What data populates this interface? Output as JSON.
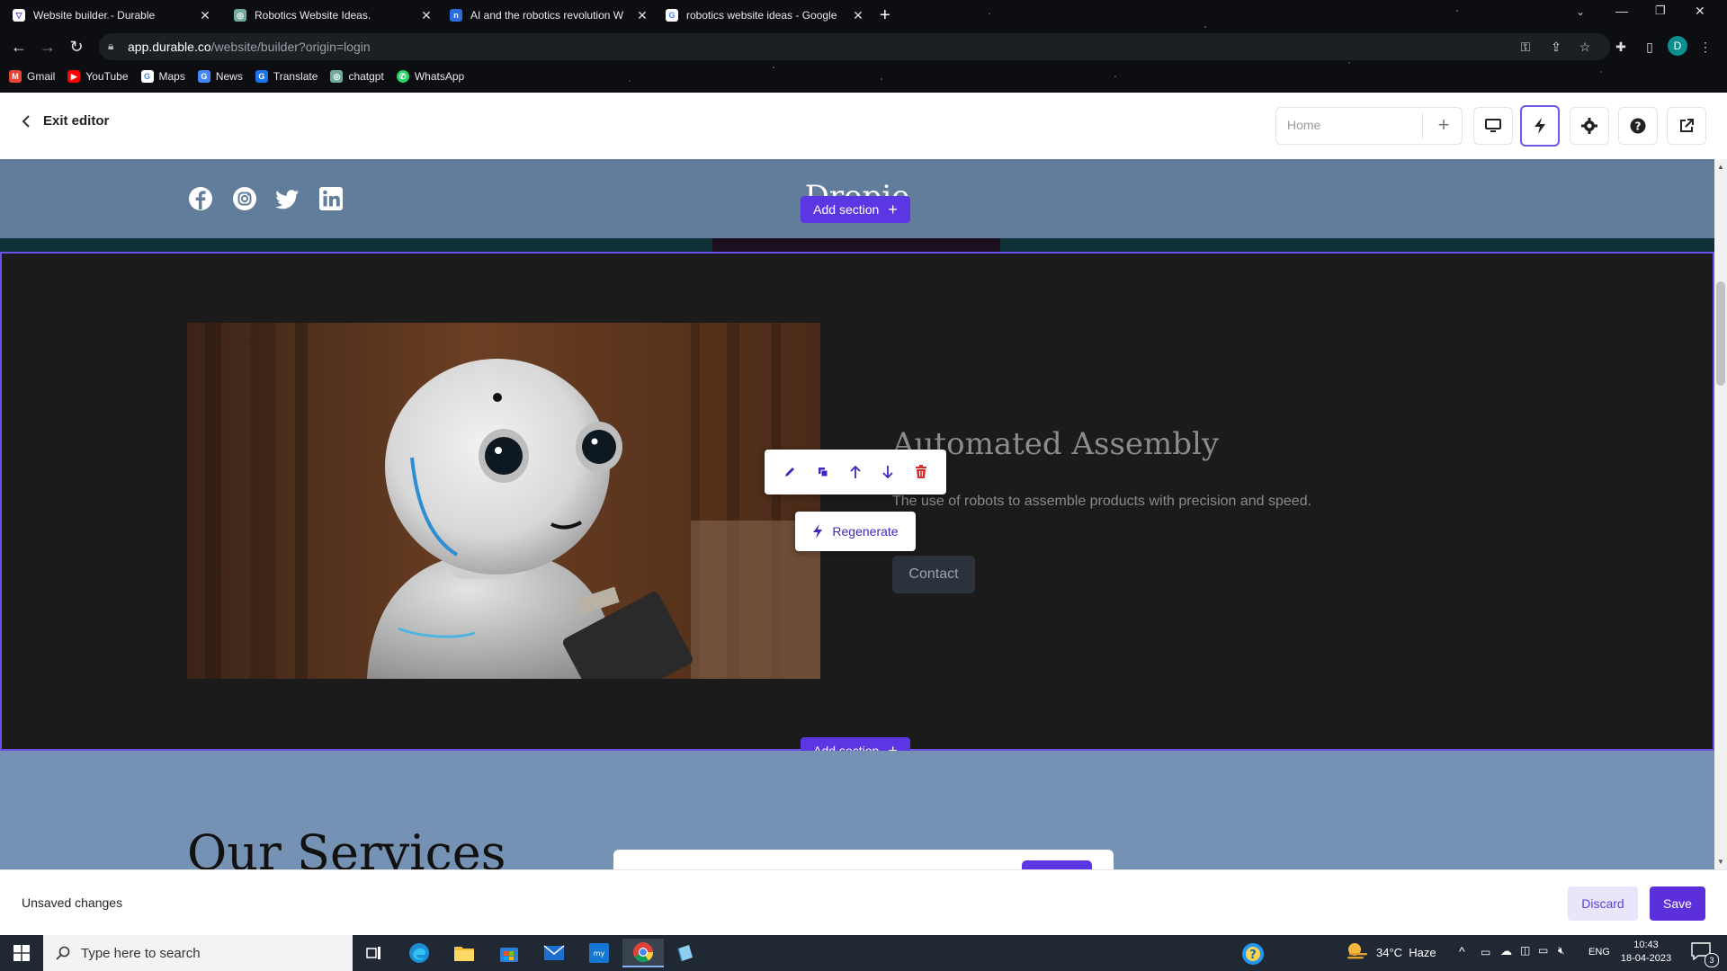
{
  "browser": {
    "tabs": [
      {
        "title": "Website builder - Durable",
        "active": true
      },
      {
        "title": "Robotics Website Ideas.",
        "active": false
      },
      {
        "title": "AI and the robotics revolution W",
        "active": false
      },
      {
        "title": "robotics website ideas - Google",
        "active": false
      }
    ],
    "url_host": "app.durable.co",
    "url_path": "/website/builder?origin=login",
    "avatar_letter": "D",
    "bookmarks": [
      "Gmail",
      "YouTube",
      "Maps",
      "News",
      "Translate",
      "chatgpt",
      "WhatsApp"
    ]
  },
  "editor": {
    "exit_label": "Exit editor",
    "page_select_value": "Home"
  },
  "site": {
    "brand": "Dropie",
    "add_section_label": "Add section",
    "hero": {
      "title": "Automated Assembly",
      "description": "The use of robots to assemble products with precision and speed.",
      "contact_label": "Contact",
      "regenerate_label": "Regenerate"
    },
    "services_title": "Our Services"
  },
  "save_bar": {
    "status": "Unsaved changes",
    "discard_label": "Discard",
    "save_label": "Save"
  },
  "taskbar": {
    "search_placeholder": "Type here to search",
    "weather": "34°C  Haze",
    "language": "ENG",
    "time": "10:43",
    "date": "18-04-2023",
    "notification_count": "3"
  },
  "colors": {
    "accent": "#5b37e3",
    "site_header": "#617d9b",
    "hero_bg": "#1b1b1b",
    "services_bg": "#7591b3"
  }
}
